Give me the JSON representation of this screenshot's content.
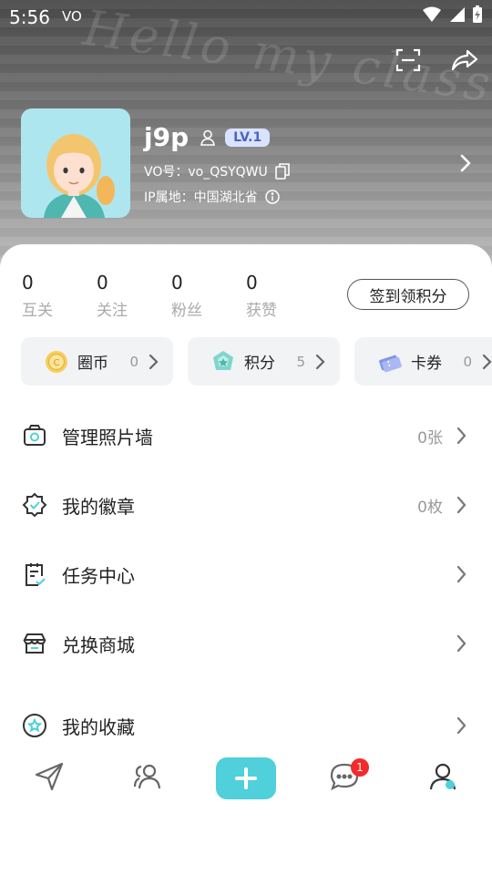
{
  "status_bar": {
    "time": "5:56",
    "vo_indicator": "VO"
  },
  "header": {
    "watermark": "Hello my class",
    "username": "j9p",
    "level": "LV.1",
    "vo_id": "VO号：vo_QSYQWU",
    "ip_location": "IP属地：中国湖北省"
  },
  "stats": [
    {
      "value": "0",
      "label": "互关"
    },
    {
      "value": "0",
      "label": "关注"
    },
    {
      "value": "0",
      "label": "粉丝"
    },
    {
      "value": "0",
      "label": "获赞"
    }
  ],
  "checkin_label": "签到领积分",
  "wallet": [
    {
      "icon": "coin-icon",
      "label": "圈币",
      "count": "0"
    },
    {
      "icon": "points-icon",
      "label": "积分",
      "count": "5"
    },
    {
      "icon": "coupon-icon",
      "label": "卡券",
      "count": "0"
    }
  ],
  "menu": [
    {
      "icon": "photo-wall-icon",
      "label": "管理照片墙",
      "value": "0张"
    },
    {
      "icon": "badge-icon",
      "label": "我的徽章",
      "value": "0枚"
    },
    {
      "icon": "task-icon",
      "label": "任务中心",
      "value": ""
    },
    {
      "icon": "shop-icon",
      "label": "兑换商城",
      "value": ""
    },
    {
      "icon": "favorite-icon",
      "label": "我的收藏",
      "value": ""
    }
  ],
  "bottom_nav": {
    "message_badge": "1"
  },
  "colors": {
    "accent": "#4fd0db",
    "badge_red": "#f32b2b",
    "level_bg": "#d9e3ff",
    "level_text": "#4c63c4"
  }
}
